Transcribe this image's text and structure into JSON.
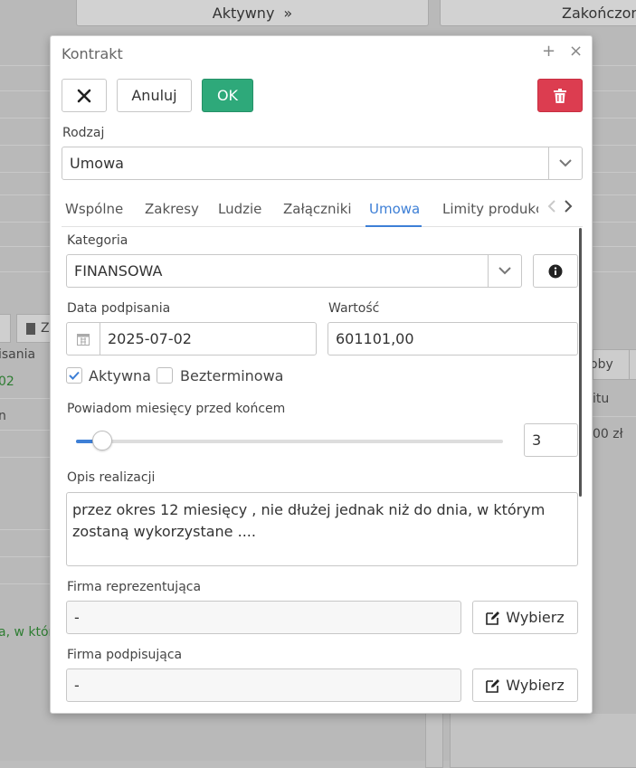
{
  "background": {
    "top_button_active": "Aktywny",
    "top_button_active_icon": "»",
    "top_button_ended": "Zakończon",
    "col_label_signing": "isania",
    "col_value_date": "02",
    "col_value_n": "n",
    "col_value_desc": "a, w któr",
    "tab_z": "Z",
    "right_label_oby": "oby",
    "right_label_itu": "itu",
    "right_value_zl": "00 zł"
  },
  "dialog": {
    "title": "Kontrakt",
    "pin_icon": "+",
    "close_icon": "×",
    "cancel_label": "Anuluj",
    "ok_label": "OK",
    "type_label": "Rodzaj",
    "type_value": "Umowa",
    "tabs": [
      {
        "label": "Wspólne"
      },
      {
        "label": "Zakresy"
      },
      {
        "label": "Ludzie"
      },
      {
        "label": "Załączniki"
      },
      {
        "label": "Umowa"
      },
      {
        "label": "Limity produkc"
      }
    ],
    "active_tab": "Umowa",
    "category_label": "Kategoria",
    "category_value": "FINANSOWA",
    "signing_date_label": "Data podpisania",
    "signing_date_value": "2025-07-02",
    "value_label": "Wartość",
    "value_value": "601101,00",
    "active_checkbox_label": "Aktywna",
    "active_checked": true,
    "indefinite_checkbox_label": "Bezterminowa",
    "indefinite_checked": false,
    "notify_label": "Powiadom miesięcy przed końcem",
    "notify_value": "3",
    "notify_fraction": 0.04,
    "description_label": "Opis realizacji",
    "description_value": "przez okres 12 miesięcy , nie dłużej jednak niż do dnia, w którym zostaną wykorzystane ....",
    "rep_company_label": "Firma reprezentująca",
    "rep_company_value": "-",
    "sign_company_label": "Firma podpisująca",
    "sign_company_value": "-",
    "pick_label": "Wybierz"
  },
  "colors": {
    "accent": "#3d7fd6",
    "ok": "#2ea97a",
    "danger": "#dc3d50"
  }
}
